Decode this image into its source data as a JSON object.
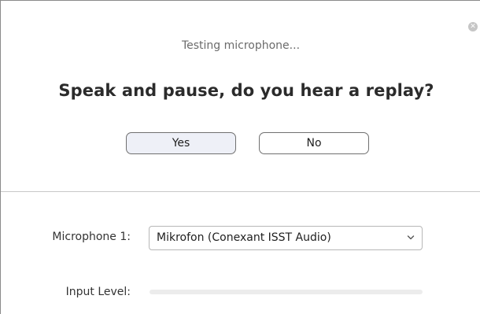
{
  "dialog": {
    "close_icon": "close-icon",
    "status_text": "Testing microphone...",
    "question": "Speak and pause, do you hear a replay?",
    "yes_label": "Yes",
    "no_label": "No"
  },
  "settings": {
    "microphone_label": "Microphone 1:",
    "microphone_selected": "Mikrofon (Conexant ISST Audio)",
    "dropdown_icon": "chevron-down-icon",
    "input_level_label": "Input Level:",
    "input_level": 0
  },
  "colors": {
    "yes_button_bg": "#eef0f7",
    "level_track": "#ececec",
    "level_fill": "#2d8cff"
  }
}
